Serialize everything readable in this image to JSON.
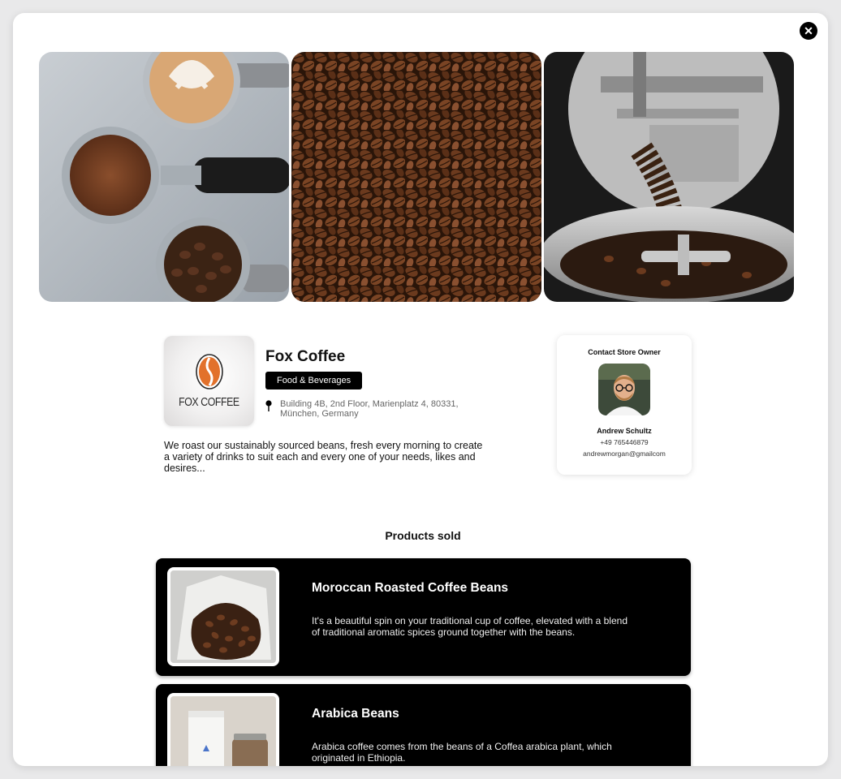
{
  "modal": {
    "close_label": "✕"
  },
  "store": {
    "name": "Fox Coffee",
    "logo_text": "FOX COFFEE",
    "category": "Food & Beverages",
    "address": "Building 4B, 2nd Floor, Marienplatz 4, 80331, München, Germany",
    "description": "We roast our sustainably sourced beans, fresh every morning to create a variety of drinks to suit each and every one of your needs, likes and desires..."
  },
  "contact": {
    "title": "Contact Store Owner",
    "name": "Andrew Schultz",
    "phone": "+49 765446879",
    "email": "andrewmorgan@gmailcom"
  },
  "products": {
    "section_title": "Products sold",
    "items": [
      {
        "title": "Moroccan Roasted Coffee Beans",
        "description": "It's a beautiful spin on your traditional cup of coffee, elevated with a blend of traditional aromatic spices ground together with the beans."
      },
      {
        "title": "Arabica Beans",
        "description": "Arabica coffee comes from the beans of a Coffea arabica plant, which originated in Ethiopia."
      }
    ]
  },
  "colors": {
    "accent": "#000000",
    "logo_orange": "#e2712b"
  }
}
